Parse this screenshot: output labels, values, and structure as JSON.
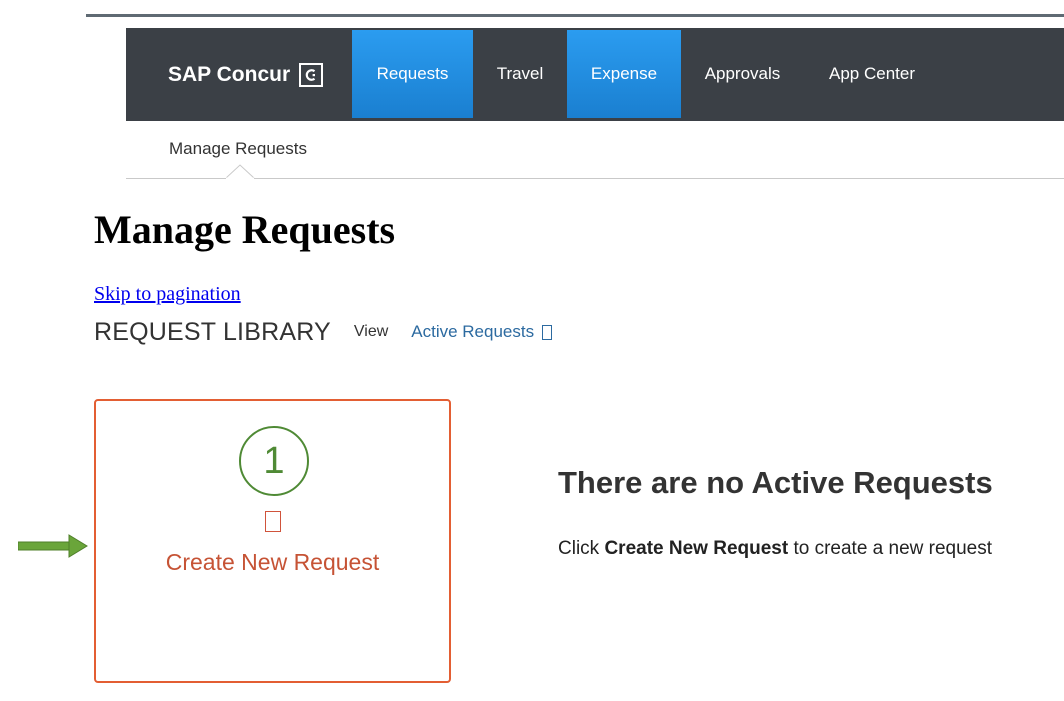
{
  "app": {
    "brand": "SAP Concur",
    "brand_mark": "C"
  },
  "nav": {
    "items": [
      {
        "label": "Requests",
        "active": true
      },
      {
        "label": "Travel",
        "active": false
      },
      {
        "label": "Expense",
        "active": true
      },
      {
        "label": "Approvals",
        "active": false
      },
      {
        "label": "App Center",
        "active": false
      }
    ]
  },
  "subnav": {
    "items": [
      {
        "label": "Manage Requests"
      }
    ]
  },
  "page": {
    "title": "Manage Requests",
    "skip_link": "Skip to pagination"
  },
  "library": {
    "label": "REQUEST LIBRARY",
    "view_label": "View",
    "filter": "Active Requests",
    "filter_icon": "chevron-down-icon"
  },
  "create_card": {
    "step_number": "1",
    "icon": "add-icon",
    "label": "Create New Request"
  },
  "empty_state": {
    "title": "There are no Active Requests",
    "text_before": "Click ",
    "text_bold": "Create New Request",
    "text_after": " to create a new request"
  },
  "colors": {
    "nav_bg": "#3b4046",
    "nav_active": "#1f8ae0",
    "card_border": "#e35e33",
    "step_green": "#4f8a35",
    "link_blue": "#2c6aa0",
    "arrow_green": "#6aa53a"
  }
}
